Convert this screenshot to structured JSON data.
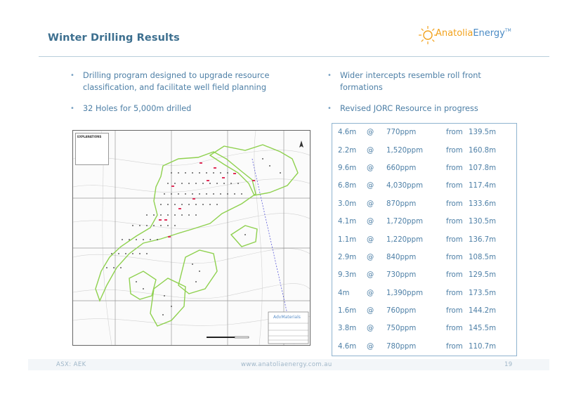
{
  "slide": {
    "title": "Winter Drilling Results",
    "logo": {
      "part1": "Anatolia",
      "part2": "Energy",
      "tm": "TM"
    }
  },
  "bullets_left": [
    "Drilling program designed to upgrade resource classification, and facilitate well field planning",
    "32 Holes for 5,000m drilled"
  ],
  "bullets_right": [
    "Wider intercepts resemble roll front formations",
    "Revised JORC Resource in progress"
  ],
  "map": {
    "legend_title": "EXPLANATIONS",
    "box_brand": "AdvMaterials"
  },
  "results": {
    "rows": [
      {
        "len": "4.6m",
        "at": "@",
        "grade": "770ppm",
        "from": "from",
        "depth": "139.5m"
      },
      {
        "len": "2.2m",
        "at": "@",
        "grade": "1,520ppm",
        "from": "from",
        "depth": "160.8m"
      },
      {
        "len": "9.6m",
        "at": "@",
        "grade": "660ppm",
        "from": "from",
        "depth": "107.8m"
      },
      {
        "len": "6.8m",
        "at": "@",
        "grade": "4,030ppm",
        "from": "from",
        "depth": "117.4m"
      },
      {
        "len": "3.0m",
        "at": "@",
        "grade": "870ppm",
        "from": "from",
        "depth": "133.6m"
      },
      {
        "len": "4.1m",
        "at": "@",
        "grade": "1,720ppm",
        "from": "from",
        "depth": "130.5m"
      },
      {
        "len": "1.1m",
        "at": "@",
        "grade": "1,220ppm",
        "from": "from",
        "depth": "136.7m"
      },
      {
        "len": "2.9m",
        "at": "@",
        "grade": "840ppm",
        "from": "from",
        "depth": "108.5m"
      },
      {
        "len": "9.3m",
        "at": "@",
        "grade": "730ppm",
        "from": "from",
        "depth": "129.5m"
      },
      {
        "len": "4m",
        "at": "@",
        "grade": "1,390ppm",
        "from": "from",
        "depth": "173.5m"
      },
      {
        "len": "1.6m",
        "at": "@",
        "grade": "760ppm",
        "from": "from",
        "depth": "144.2m"
      },
      {
        "len": "3.8m",
        "at": "@",
        "grade": "750ppm",
        "from": "from",
        "depth": "145.5m"
      },
      {
        "len": "4.6m",
        "at": "@",
        "grade": "780ppm",
        "from": "from",
        "depth": "110.7m"
      }
    ]
  },
  "footer": {
    "ticker": "ASX: AEK",
    "website": "www.anatoliaenergy.com.au",
    "page": "19"
  },
  "colors": {
    "title": "#3d6f8f",
    "text": "#4d7fa6",
    "zone": "#8fd14f",
    "hole_hit": "#e0305a"
  }
}
